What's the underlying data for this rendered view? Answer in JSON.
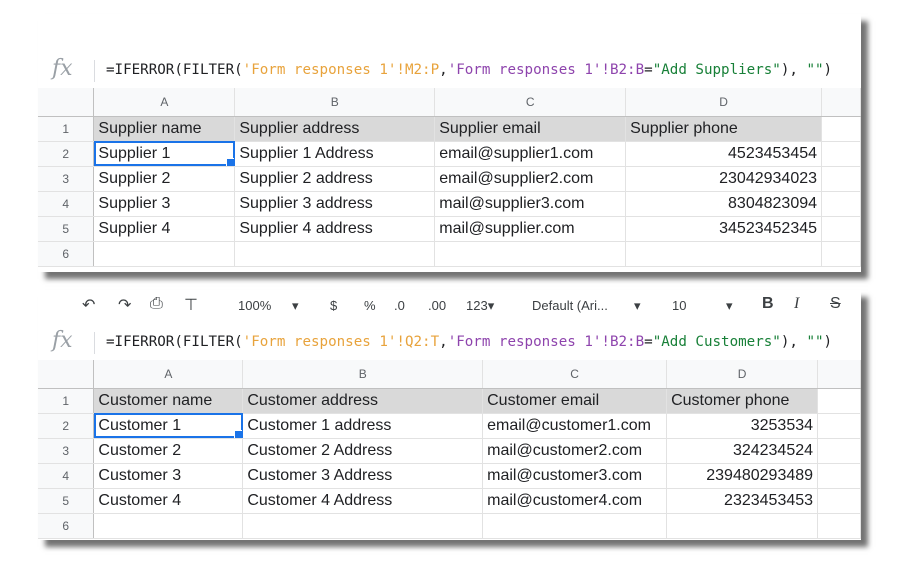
{
  "sheet1": {
    "formula": {
      "part1": "=IFERROR(FILTER(",
      "range1": "'Form responses 1'!M2:P",
      "comma1": ",",
      "range2": "'Form responses 1'!B2:B",
      "eq": "=",
      "crit": "\"Add Suppliers\"",
      "mid": "), ",
      "empty": "\"\"",
      "end": ")"
    },
    "columns": [
      "A",
      "B",
      "C",
      "D"
    ],
    "row_numbers": [
      "1",
      "2",
      "3",
      "4",
      "5",
      "6"
    ],
    "rows": [
      [
        "Supplier name",
        "Supplier address",
        "Supplier email",
        "Supplier phone"
      ],
      [
        "Supplier 1",
        "Supplier 1 Address",
        "email@supplier1.com",
        "4523453454"
      ],
      [
        "Supplier 2",
        "Supplier 2 address",
        "email@supplier2.com",
        "23042934023"
      ],
      [
        "Supplier 3",
        "Supplier 3 address",
        "mail@supplier3.com",
        "8304823094"
      ],
      [
        "Supplier 4",
        "Supplier 4 address",
        "mail@supplier.com",
        "34523452345"
      ],
      [
        "",
        "",
        "",
        ""
      ]
    ]
  },
  "sheet2": {
    "toolbar": {
      "zoom": "100%",
      "currency": "$",
      "percent": "%",
      "dec_less": ".0",
      "dec_more": ".00",
      "format": "123",
      "font": "Default (Ari...",
      "size": "10",
      "bold": "B",
      "italic": "I",
      "strike": "S"
    },
    "formula": {
      "part1": "=IFERROR(FILTER(",
      "range1": "'Form responses 1'!Q2:T",
      "comma1": ",",
      "range2": "'Form responses 1'!B2:B",
      "eq": "=",
      "crit": "\"Add Customers\"",
      "mid": "), ",
      "empty": "\"\"",
      "end": ")"
    },
    "columns": [
      "A",
      "B",
      "C",
      "D"
    ],
    "row_numbers": [
      "1",
      "2",
      "3",
      "4",
      "5",
      "6"
    ],
    "rows": [
      [
        "Customer name",
        "Customer address",
        "Customer email",
        "Customer phone"
      ],
      [
        "Customer 1",
        "Customer 1 address",
        "email@customer1.com",
        "3253534"
      ],
      [
        "Customer 2",
        "Customer 2 Address",
        "mail@customer2.com",
        "324234524"
      ],
      [
        "Customer 3",
        "Customer 3 Address",
        "mail@customer3.com",
        "239480293489"
      ],
      [
        "Customer 4",
        "Customer 4 Address",
        "mail@customer4.com",
        "2323453453"
      ],
      [
        "",
        "",
        "",
        ""
      ]
    ]
  },
  "fx_label": "fx"
}
